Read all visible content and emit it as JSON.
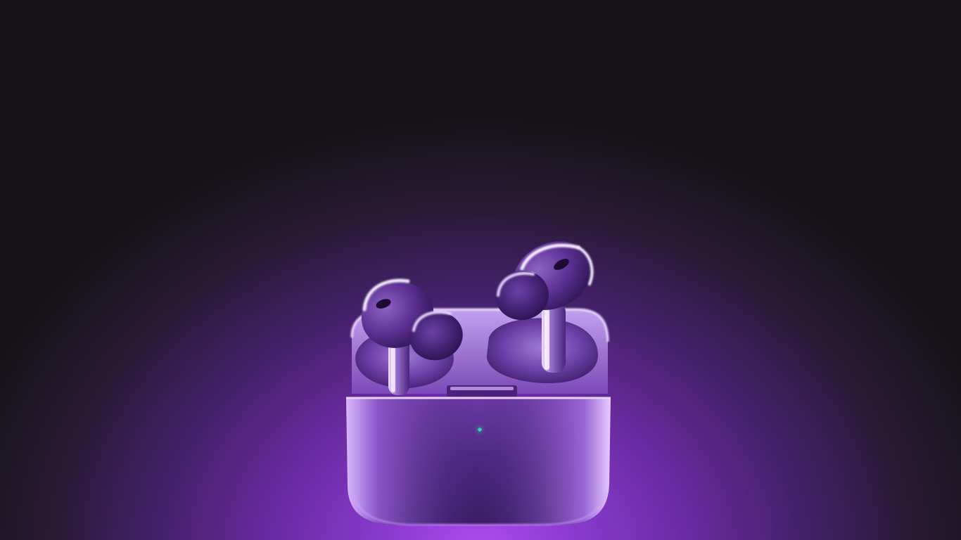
{
  "scene": {
    "subject": "wireless-earbuds-in-open-charging-case",
    "colors": {
      "background_dark": "#141216",
      "glow": "#b04cf2",
      "case_body": "#5b2f90",
      "case_highlight": "#c9a6f0",
      "earbud_body": "#7a4cb0",
      "earbud_highlight": "#f3e8ff",
      "status_light": "#27e0a8"
    }
  }
}
